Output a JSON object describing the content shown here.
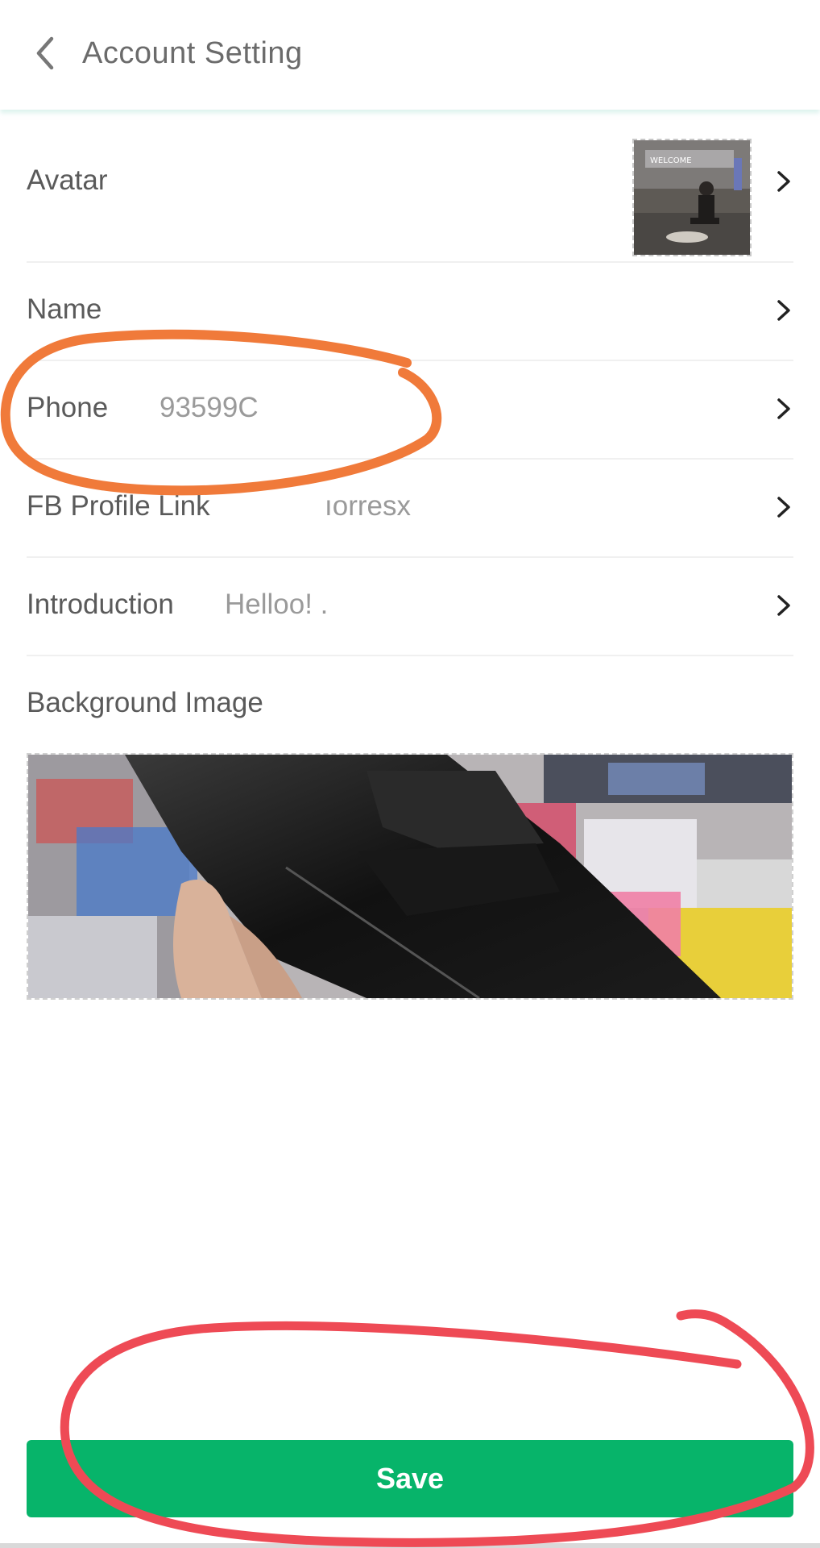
{
  "header": {
    "title": "Account Setting"
  },
  "rows": {
    "avatar": {
      "label": "Avatar"
    },
    "name": {
      "label": "Name",
      "value": ""
    },
    "phone": {
      "label": "Phone",
      "value": "93599C"
    },
    "fb": {
      "label": "FB Profile Link",
      "value": "ıorresx"
    },
    "intro": {
      "label": "Introduction",
      "value": "Helloo! ."
    }
  },
  "background": {
    "label": "Background Image"
  },
  "footer": {
    "save_label": "Save"
  },
  "colors": {
    "accent": "#07b46a",
    "annotation_orange": "#f07a3a",
    "annotation_red": "#ee4a55"
  },
  "icons": [
    "chevron-left-icon",
    "chevron-right-icon"
  ]
}
